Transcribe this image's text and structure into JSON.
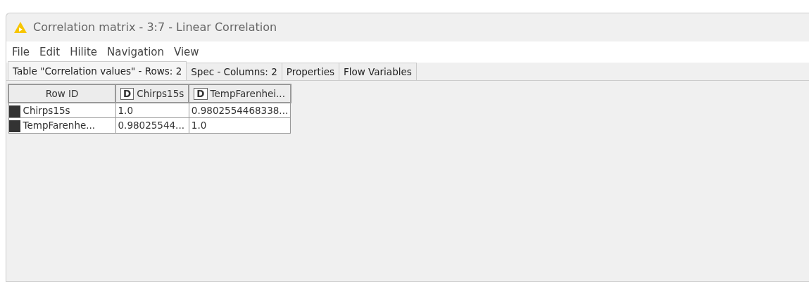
{
  "window": {
    "title": "Correlation matrix - 3:7 - Linear Correlation"
  },
  "menu": [
    "File",
    "Edit",
    "Hilite",
    "Navigation",
    "View"
  ],
  "tabs": [
    {
      "label": "Table \"Correlation values\" - Rows: 2",
      "selected": true
    },
    {
      "label": "Spec - Columns: 2",
      "selected": false
    },
    {
      "label": "Properties",
      "selected": false
    },
    {
      "label": "Flow Variables",
      "selected": false
    }
  ],
  "table": {
    "row_id_header": "Row ID",
    "columns": [
      {
        "type": "D",
        "name": "Chirps15s"
      },
      {
        "type": "D",
        "name": "TempFarenhei..."
      }
    ],
    "rows": [
      {
        "id": "Chirps15s",
        "cells": [
          "1.0",
          "0.9802554468338..."
        ]
      },
      {
        "id": "TempFarenhe...",
        "cells": [
          "0.98025544...",
          "1.0"
        ]
      }
    ]
  }
}
